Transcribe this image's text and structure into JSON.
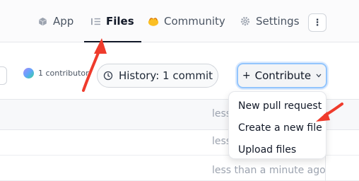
{
  "nav": {
    "tabs": [
      {
        "label": "App",
        "icon": "cube-icon",
        "active": false
      },
      {
        "label": "Files",
        "icon": "files-icon",
        "active": true
      },
      {
        "label": "Community",
        "icon": "community-emoji-icon",
        "active": false
      },
      {
        "label": "Settings",
        "icon": "gear-icon",
        "active": false
      }
    ],
    "more_label": "⋮"
  },
  "repo": {
    "contributors_label": "1 contributor",
    "history_label": "History: 1 commit",
    "contribute_label": "Contribute",
    "contribute_prefix": "+"
  },
  "contribute_menu": {
    "items": [
      "New pull request",
      "Create a new file",
      "Upload files"
    ]
  },
  "files_table": {
    "times": [
      "less",
      "less",
      "less than a minute ago"
    ]
  },
  "colors": {
    "annotation_arrow": "#ef3b2c",
    "contribute_focus": "#93c5fd"
  }
}
